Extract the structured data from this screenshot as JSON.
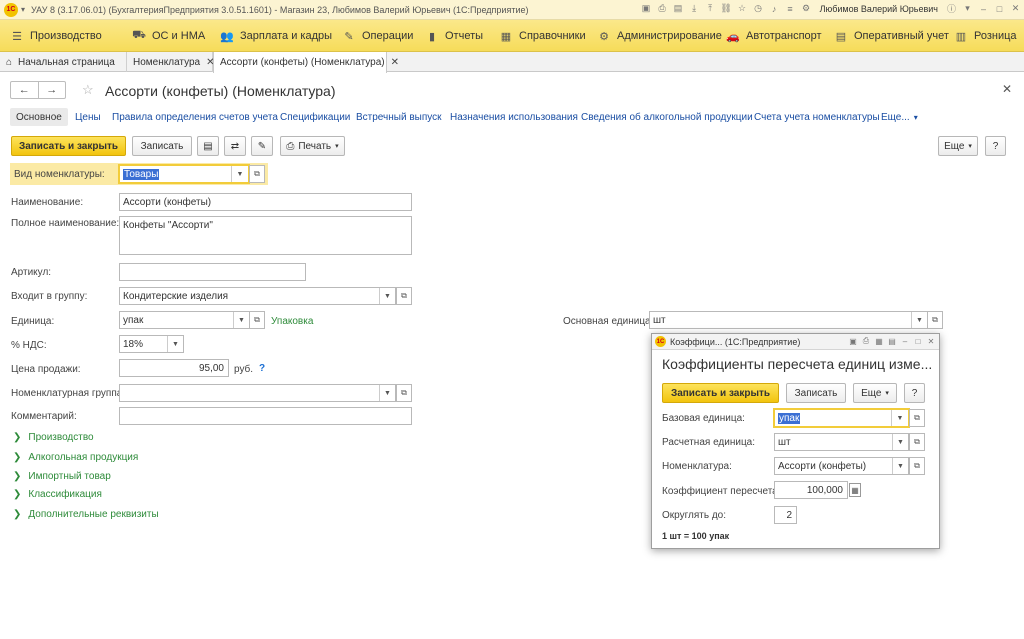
{
  "titlebar": {
    "title": "УАУ 8 (3.17.06.01) (БухгалтерияПредприятия 3.0.51.1601) - Магазин 23, Любимов Валерий Юрьевич  (1С:Предприятие)",
    "user": "Любимов Валерий Юрьевич",
    "logo": "1С"
  },
  "sections": [
    {
      "label": "Производство",
      "icon": "menu-icon"
    },
    {
      "label": "ОС и НМА",
      "icon": "truck-icon"
    },
    {
      "label": "Зарплата и кадры",
      "icon": "people-icon"
    },
    {
      "label": "Операции",
      "icon": "operations-icon"
    },
    {
      "label": "Отчеты",
      "icon": "chart-icon"
    },
    {
      "label": "Справочники",
      "icon": "book-icon"
    },
    {
      "label": "Администрирование",
      "icon": "gear-icon"
    },
    {
      "label": "Автотранспорт",
      "icon": "car-icon"
    },
    {
      "label": "Оперативный учет",
      "icon": "list-icon"
    },
    {
      "label": "Розница",
      "icon": "store-icon"
    }
  ],
  "tabs": [
    {
      "label": "Начальная страница"
    },
    {
      "label": "Номенклатура"
    },
    {
      "label": "Ассорти (конфеты) (Номенклатура)"
    }
  ],
  "form": {
    "title": "Ассорти (конфеты) (Номенклатура)",
    "links": [
      "Основное",
      "Цены",
      "Правила определения счетов учета",
      "Спецификации",
      "Встречный выпуск",
      "Назначения использования",
      "Сведения об алкогольной продукции",
      "Счета учета номенклатуры",
      "Еще..."
    ],
    "buttons": {
      "save_close": "Записать и закрыть",
      "save": "Записать",
      "print": "Печать",
      "more": "Еще",
      "help": "?"
    },
    "fields": {
      "kind_label": "Вид номенклатуры:",
      "kind_value": "Товары",
      "name_label": "Наименование:",
      "name_value": "Ассорти (конфеты)",
      "fullname_label": "Полное наименование:",
      "fullname_value": "Конфеты \"Ассорти\"",
      "article_label": "Артикул:",
      "article_value": "",
      "group_label": "Входит в группу:",
      "group_value": "Кондитерские изделия",
      "unit_label": "Единица:",
      "unit_value": "упак",
      "unit_hint": "Упаковка",
      "main_unit_label": "Основная единица:",
      "main_unit_value": "шт",
      "vat_label": "% НДС:",
      "vat_value": "18%",
      "price_label": "Цена продажи:",
      "price_value": "95,00",
      "price_currency": "руб.",
      "price_help": "?",
      "nomgroup_label": "Номенклатурная группа:",
      "nomgroup_value": "",
      "comment_label": "Комментарий:",
      "comment_value": ""
    },
    "groups": [
      "Производство",
      "Алкогольная продукция",
      "Импортный товар",
      "Классификация",
      "Дополнительные реквизиты"
    ]
  },
  "dialog": {
    "window_title": "Коэффици... (1С:Предприятие)",
    "heading": "Коэффициенты пересчета единиц изме...",
    "buttons": {
      "save_close": "Записать и закрыть",
      "save": "Записать",
      "more": "Еще",
      "help": "?"
    },
    "base_unit_label": "Базовая единица:",
    "base_unit_value": "упак",
    "calc_unit_label": "Расчетная единица:",
    "calc_unit_value": "шт",
    "nomen_label": "Номенклатура:",
    "nomen_value": "Ассорти (конфеты)",
    "coef_label": "Коэффициент пересчета:",
    "coef_value": "100,000",
    "round_label": "Округлять до:",
    "round_value": "2",
    "formula": "1 шт = 100 упак"
  }
}
